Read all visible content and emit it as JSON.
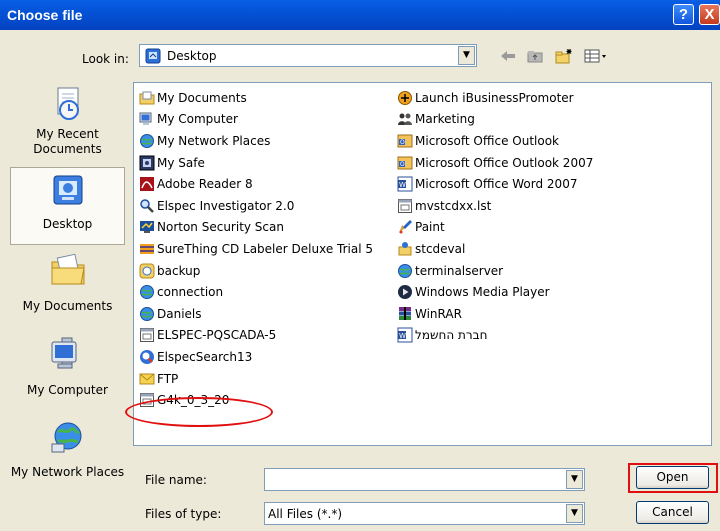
{
  "window": {
    "title": "Choose file",
    "help_label": "?",
    "close_label": "X"
  },
  "look_in": {
    "label": "Look in:",
    "value": "Desktop"
  },
  "toolbar": [
    "back-icon",
    "up-folder-icon",
    "new-folder-icon",
    "view-menu-icon"
  ],
  "places": [
    {
      "label": "My Recent Documents",
      "icon": "recent-documents-icon"
    },
    {
      "label": "Desktop",
      "icon": "desktop-icon",
      "selected": true
    },
    {
      "label": "My Documents",
      "icon": "my-documents-icon"
    },
    {
      "label": "My Computer",
      "icon": "my-computer-icon"
    },
    {
      "label": "My Network Places",
      "icon": "network-places-icon"
    }
  ],
  "files_col1": [
    {
      "name": "My Documents",
      "icon": "folder"
    },
    {
      "name": "My Computer",
      "icon": "computer"
    },
    {
      "name": "My Network Places",
      "icon": "network"
    },
    {
      "name": "My Safe",
      "icon": "safe"
    },
    {
      "name": "Adobe Reader 8",
      "icon": "pdf"
    },
    {
      "name": "Elspec Investigator 2.0",
      "icon": "app"
    },
    {
      "name": "Norton Security Scan",
      "icon": "shield"
    },
    {
      "name": "SureThing CD Labeler Deluxe Trial 5",
      "icon": "cd"
    },
    {
      "name": "backup",
      "icon": "shortcut"
    },
    {
      "name": "connection",
      "icon": "network"
    },
    {
      "name": "Daniels",
      "icon": "network"
    },
    {
      "name": "ELSPEC-PQSCADA-5",
      "icon": "file"
    },
    {
      "name": "ElspecSearch13",
      "icon": "search"
    },
    {
      "name": "FTP",
      "icon": "mail"
    },
    {
      "name": "G4k_0_3_20",
      "icon": "file"
    }
  ],
  "files_col2": [
    {
      "name": "Launch iBusinessPromoter",
      "icon": "app"
    },
    {
      "name": "Marketing",
      "icon": "people"
    },
    {
      "name": "Microsoft Office Outlook",
      "icon": "outlook"
    },
    {
      "name": "Microsoft Office Outlook 2007",
      "icon": "outlook"
    },
    {
      "name": "Microsoft Office Word 2007",
      "icon": "word"
    },
    {
      "name": "mvstcdxx.lst",
      "icon": "file"
    },
    {
      "name": "Paint",
      "icon": "paint"
    },
    {
      "name": "stcdeval",
      "icon": "app"
    },
    {
      "name": "terminalserver",
      "icon": "network"
    },
    {
      "name": "Windows Media Player",
      "icon": "media"
    },
    {
      "name": "WinRAR",
      "icon": "rar"
    },
    {
      "name": "חברת החשמל",
      "icon": "word"
    }
  ],
  "file_name": {
    "label": "File name:",
    "value": ""
  },
  "file_type": {
    "label": "Files of type:",
    "value": "All Files (*.*)"
  },
  "buttons": {
    "open": "Open",
    "cancel": "Cancel"
  },
  "colors": {
    "titlebar": "#0453d6",
    "highlight": "#e01010",
    "dialog_bg": "#ece9d8"
  }
}
